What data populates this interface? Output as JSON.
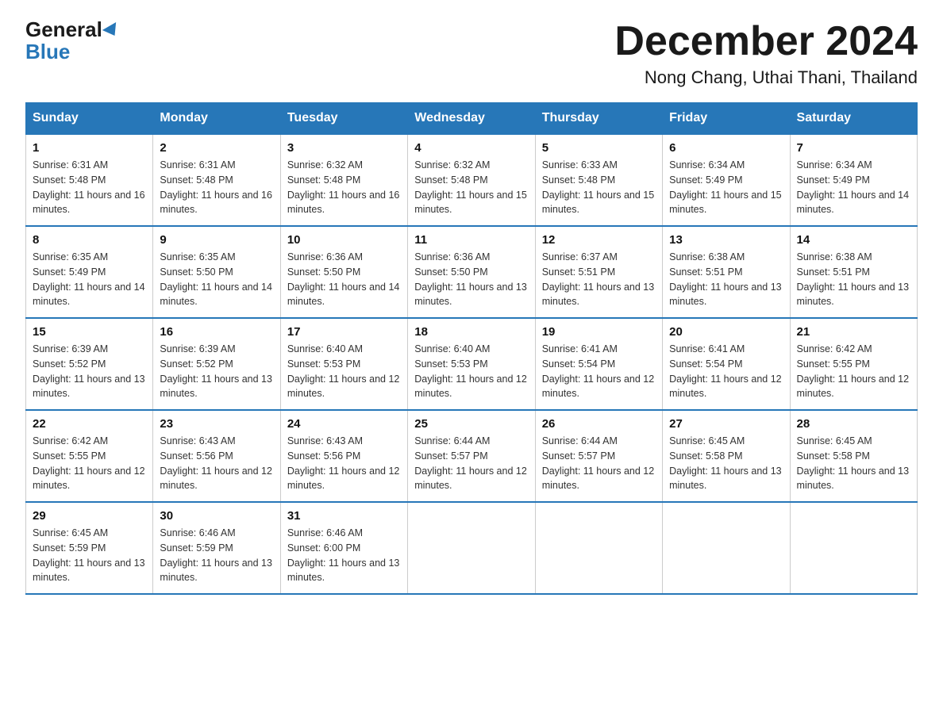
{
  "header": {
    "logo_general": "General",
    "logo_blue": "Blue",
    "month_title": "December 2024",
    "location": "Nong Chang, Uthai Thani, Thailand"
  },
  "calendar": {
    "days_of_week": [
      "Sunday",
      "Monday",
      "Tuesday",
      "Wednesday",
      "Thursday",
      "Friday",
      "Saturday"
    ],
    "weeks": [
      [
        {
          "day": "1",
          "sunrise": "6:31 AM",
          "sunset": "5:48 PM",
          "daylight": "11 hours and 16 minutes."
        },
        {
          "day": "2",
          "sunrise": "6:31 AM",
          "sunset": "5:48 PM",
          "daylight": "11 hours and 16 minutes."
        },
        {
          "day": "3",
          "sunrise": "6:32 AM",
          "sunset": "5:48 PM",
          "daylight": "11 hours and 16 minutes."
        },
        {
          "day": "4",
          "sunrise": "6:32 AM",
          "sunset": "5:48 PM",
          "daylight": "11 hours and 15 minutes."
        },
        {
          "day": "5",
          "sunrise": "6:33 AM",
          "sunset": "5:48 PM",
          "daylight": "11 hours and 15 minutes."
        },
        {
          "day": "6",
          "sunrise": "6:34 AM",
          "sunset": "5:49 PM",
          "daylight": "11 hours and 15 minutes."
        },
        {
          "day": "7",
          "sunrise": "6:34 AM",
          "sunset": "5:49 PM",
          "daylight": "11 hours and 14 minutes."
        }
      ],
      [
        {
          "day": "8",
          "sunrise": "6:35 AM",
          "sunset": "5:49 PM",
          "daylight": "11 hours and 14 minutes."
        },
        {
          "day": "9",
          "sunrise": "6:35 AM",
          "sunset": "5:50 PM",
          "daylight": "11 hours and 14 minutes."
        },
        {
          "day": "10",
          "sunrise": "6:36 AM",
          "sunset": "5:50 PM",
          "daylight": "11 hours and 14 minutes."
        },
        {
          "day": "11",
          "sunrise": "6:36 AM",
          "sunset": "5:50 PM",
          "daylight": "11 hours and 13 minutes."
        },
        {
          "day": "12",
          "sunrise": "6:37 AM",
          "sunset": "5:51 PM",
          "daylight": "11 hours and 13 minutes."
        },
        {
          "day": "13",
          "sunrise": "6:38 AM",
          "sunset": "5:51 PM",
          "daylight": "11 hours and 13 minutes."
        },
        {
          "day": "14",
          "sunrise": "6:38 AM",
          "sunset": "5:51 PM",
          "daylight": "11 hours and 13 minutes."
        }
      ],
      [
        {
          "day": "15",
          "sunrise": "6:39 AM",
          "sunset": "5:52 PM",
          "daylight": "11 hours and 13 minutes."
        },
        {
          "day": "16",
          "sunrise": "6:39 AM",
          "sunset": "5:52 PM",
          "daylight": "11 hours and 13 minutes."
        },
        {
          "day": "17",
          "sunrise": "6:40 AM",
          "sunset": "5:53 PM",
          "daylight": "11 hours and 12 minutes."
        },
        {
          "day": "18",
          "sunrise": "6:40 AM",
          "sunset": "5:53 PM",
          "daylight": "11 hours and 12 minutes."
        },
        {
          "day": "19",
          "sunrise": "6:41 AM",
          "sunset": "5:54 PM",
          "daylight": "11 hours and 12 minutes."
        },
        {
          "day": "20",
          "sunrise": "6:41 AM",
          "sunset": "5:54 PM",
          "daylight": "11 hours and 12 minutes."
        },
        {
          "day": "21",
          "sunrise": "6:42 AM",
          "sunset": "5:55 PM",
          "daylight": "11 hours and 12 minutes."
        }
      ],
      [
        {
          "day": "22",
          "sunrise": "6:42 AM",
          "sunset": "5:55 PM",
          "daylight": "11 hours and 12 minutes."
        },
        {
          "day": "23",
          "sunrise": "6:43 AM",
          "sunset": "5:56 PM",
          "daylight": "11 hours and 12 minutes."
        },
        {
          "day": "24",
          "sunrise": "6:43 AM",
          "sunset": "5:56 PM",
          "daylight": "11 hours and 12 minutes."
        },
        {
          "day": "25",
          "sunrise": "6:44 AM",
          "sunset": "5:57 PM",
          "daylight": "11 hours and 12 minutes."
        },
        {
          "day": "26",
          "sunrise": "6:44 AM",
          "sunset": "5:57 PM",
          "daylight": "11 hours and 12 minutes."
        },
        {
          "day": "27",
          "sunrise": "6:45 AM",
          "sunset": "5:58 PM",
          "daylight": "11 hours and 13 minutes."
        },
        {
          "day": "28",
          "sunrise": "6:45 AM",
          "sunset": "5:58 PM",
          "daylight": "11 hours and 13 minutes."
        }
      ],
      [
        {
          "day": "29",
          "sunrise": "6:45 AM",
          "sunset": "5:59 PM",
          "daylight": "11 hours and 13 minutes."
        },
        {
          "day": "30",
          "sunrise": "6:46 AM",
          "sunset": "5:59 PM",
          "daylight": "11 hours and 13 minutes."
        },
        {
          "day": "31",
          "sunrise": "6:46 AM",
          "sunset": "6:00 PM",
          "daylight": "11 hours and 13 minutes."
        },
        null,
        null,
        null,
        null
      ]
    ]
  }
}
